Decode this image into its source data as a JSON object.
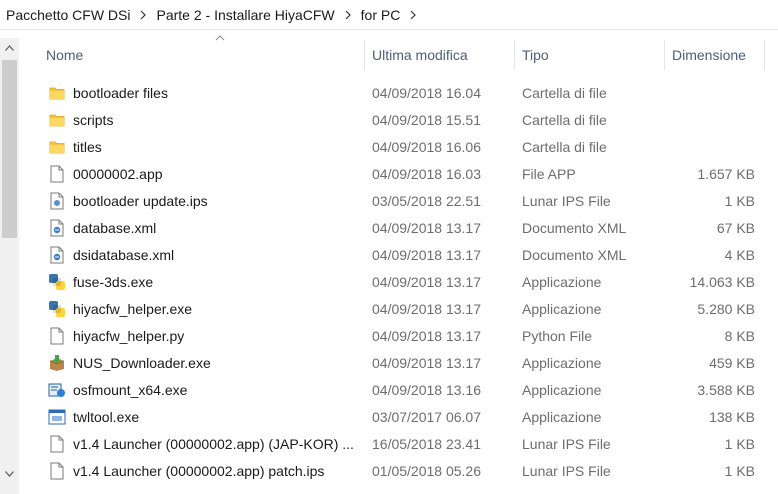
{
  "breadcrumb": [
    "Pacchetto CFW DSi",
    "Parte 2 - Installare HiyaCFW",
    "for PC"
  ],
  "columns": {
    "name": "Nome",
    "date": "Ultima modifica",
    "type": "Tipo",
    "size": "Dimensione"
  },
  "files": [
    {
      "icon": "folder-icon",
      "name": "bootloader files",
      "date": "04/09/2018 16.04",
      "type": "Cartella di file",
      "size": ""
    },
    {
      "icon": "folder-icon",
      "name": "scripts",
      "date": "04/09/2018 15.51",
      "type": "Cartella di file",
      "size": ""
    },
    {
      "icon": "folder-icon",
      "name": "titles",
      "date": "04/09/2018 16.06",
      "type": "Cartella di file",
      "size": ""
    },
    {
      "icon": "file-icon",
      "name": "00000002.app",
      "date": "04/09/2018 16.03",
      "type": "File APP",
      "size": "1.657 KB"
    },
    {
      "icon": "ips-file-icon",
      "name": "bootloader update.ips",
      "date": "03/05/2018 22.51",
      "type": "Lunar IPS File",
      "size": "1 KB"
    },
    {
      "icon": "xml-file-icon",
      "name": "database.xml",
      "date": "04/09/2018 13.17",
      "type": "Documento XML",
      "size": "67 KB"
    },
    {
      "icon": "xml-file-icon",
      "name": "dsidatabase.xml",
      "date": "04/09/2018 13.17",
      "type": "Documento XML",
      "size": "4 KB"
    },
    {
      "icon": "python-exe-icon",
      "name": "fuse-3ds.exe",
      "date": "04/09/2018 13.17",
      "type": "Applicazione",
      "size": "14.063 KB"
    },
    {
      "icon": "python-exe-icon",
      "name": "hiyacfw_helper.exe",
      "date": "04/09/2018 13.17",
      "type": "Applicazione",
      "size": "5.280 KB"
    },
    {
      "icon": "file-icon",
      "name": "hiyacfw_helper.py",
      "date": "04/09/2018 13.17",
      "type": "Python File",
      "size": "8 KB"
    },
    {
      "icon": "package-exe-icon",
      "name": "NUS_Downloader.exe",
      "date": "04/09/2018 13.17",
      "type": "Applicazione",
      "size": "459 KB"
    },
    {
      "icon": "osfmount-exe-icon",
      "name": "osfmount_x64.exe",
      "date": "04/09/2018 13.16",
      "type": "Applicazione",
      "size": "3.588 KB"
    },
    {
      "icon": "window-exe-icon",
      "name": "twltool.exe",
      "date": "03/07/2017 06.07",
      "type": "Applicazione",
      "size": "138 KB"
    },
    {
      "icon": "file-icon",
      "name": "v1.4 Launcher (00000002.app) (JAP-KOR) ...",
      "date": "16/05/2018 23.41",
      "type": "Lunar IPS File",
      "size": "1 KB"
    },
    {
      "icon": "file-icon",
      "name": "v1.4 Launcher (00000002.app) patch.ips",
      "date": "01/05/2018 05.26",
      "type": "Lunar IPS File",
      "size": "1 KB"
    }
  ]
}
